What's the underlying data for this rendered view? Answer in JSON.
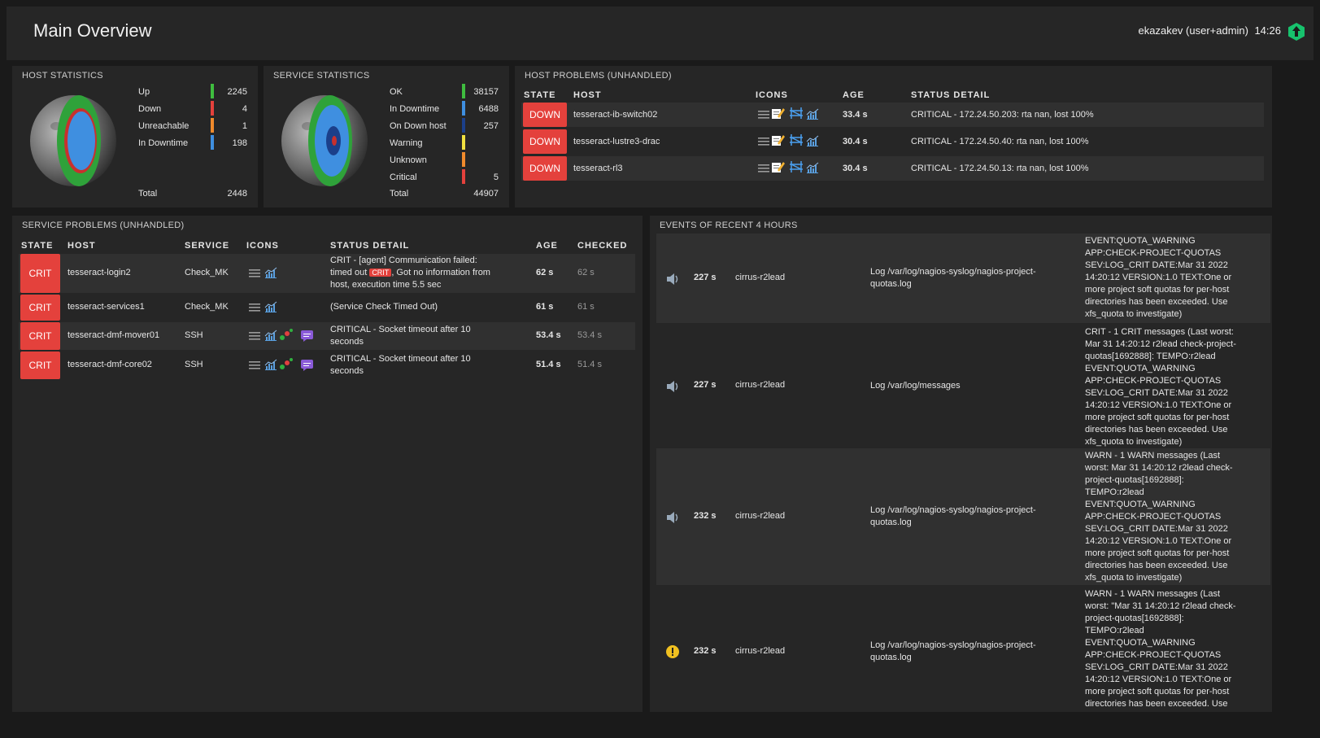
{
  "header": {
    "title": "Main Overview",
    "user": "ekazakev (user+admin)",
    "time": "14:26",
    "logo_icon": "checkmk-logo-icon"
  },
  "host_stats": {
    "title": "HOST STATISTICS",
    "rows": [
      {
        "label": "Up",
        "value": "2245",
        "color": "#3fbd3f"
      },
      {
        "label": "Down",
        "value": "4",
        "color": "#e4413c"
      },
      {
        "label": "Unreachable",
        "value": "1",
        "color": "#f08a2c"
      },
      {
        "label": "In Downtime",
        "value": "198",
        "color": "#3f8fe0"
      }
    ],
    "total_label": "Total",
    "total_value": "2448"
  },
  "service_stats": {
    "title": "SERVICE STATISTICS",
    "rows": [
      {
        "label": "OK",
        "value": "38157",
        "color": "#3fbd3f"
      },
      {
        "label": "In Downtime",
        "value": "6488",
        "color": "#3f8fe0"
      },
      {
        "label": "On Down host",
        "value": "257",
        "color": "#1b3f8a"
      },
      {
        "label": "Warning",
        "value": "",
        "color": "#f0e040"
      },
      {
        "label": "Unknown",
        "value": "",
        "color": "#f08a2c"
      },
      {
        "label": "Critical",
        "value": "5",
        "color": "#e4413c"
      }
    ],
    "total_label": "Total",
    "total_value": "44907"
  },
  "host_problems": {
    "title": "HOST PROBLEMS (UNHANDLED)",
    "columns": [
      "STATE",
      "HOST",
      "ICONS",
      "AGE",
      "STATUS DETAIL"
    ],
    "rows": [
      {
        "state": "DOWN",
        "host": "tesseract-ib-switch02",
        "age": "33.4 s",
        "detail": "CRITICAL - 172.24.50.203: rta nan, lost 100%"
      },
      {
        "state": "DOWN",
        "host": "tesseract-lustre3-drac",
        "age": "30.4 s",
        "detail": "CRITICAL - 172.24.50.40: rta nan, lost 100%"
      },
      {
        "state": "DOWN",
        "host": "tesseract-rl3",
        "age": "30.4 s",
        "detail": "CRITICAL - 172.24.50.13: rta nan, lost 100%"
      }
    ]
  },
  "service_problems": {
    "title": "SERVICE PROBLEMS (UNHANDLED)",
    "columns": [
      "STATE",
      "HOST",
      "SERVICE",
      "ICONS",
      "STATUS DETAIL",
      "AGE",
      "CHECKED"
    ],
    "rows": [
      {
        "state": "CRIT",
        "host": "tesseract-login2",
        "service": "Check_MK",
        "detail_line1": "CRIT - [agent] Communication failed:",
        "detail_pre": "timed out ",
        "detail_badge": "CRIT",
        "detail_post": ", Got no information from",
        "detail_line3": "host, execution time 5.5 sec",
        "age": "62 s",
        "checked": "62 s"
      },
      {
        "state": "CRIT",
        "host": "tesseract-services1",
        "service": "Check_MK",
        "detail": "(Service Check Timed Out)",
        "age": "61 s",
        "checked": "61 s"
      },
      {
        "state": "CRIT",
        "host": "tesseract-dmf-mover01",
        "service": "SSH",
        "detail_line1": "CRITICAL - Socket timeout after 10",
        "detail_line2": "seconds",
        "age": "53.4 s",
        "checked": "53.4 s"
      },
      {
        "state": "CRIT",
        "host": "tesseract-dmf-core02",
        "service": "SSH",
        "detail_line1": "CRITICAL - Socket timeout after 10",
        "detail_line2": "seconds",
        "age": "51.4 s",
        "checked": "51.4 s"
      }
    ]
  },
  "events": {
    "title": "EVENTS OF RECENT 4 HOURS",
    "rows": [
      {
        "icon": "speaker-icon",
        "age": "227 s",
        "host": "cirrus-r2lead",
        "log": [
          "Log /var/log/nagios-syslog/nagios-project-",
          "quotas.log"
        ],
        "text": [
          "EVENT:QUOTA_WARNING",
          "APP:CHECK-PROJECT-QUOTAS",
          "SEV:LOG_CRIT DATE:Mar 31 2022",
          "14:20:12 VERSION:1.0 TEXT:One or",
          "more project soft quotas for per-host",
          "directories has been exceeded. Use",
          "xfs_quota to investigate)"
        ]
      },
      {
        "icon": "speaker-icon",
        "age": "227 s",
        "host": "cirrus-r2lead",
        "log": [
          "Log /var/log/messages"
        ],
        "text": [
          "CRIT - 1 CRIT messages (Last worst:",
          "Mar 31 14:20:12 r2lead check-project-",
          "quotas[1692888]: TEMPO:r2lead",
          "EVENT:QUOTA_WARNING",
          "APP:CHECK-PROJECT-QUOTAS",
          "SEV:LOG_CRIT DATE:Mar 31 2022",
          "14:20:12 VERSION:1.0 TEXT:One or",
          "more project soft quotas for per-host",
          "directories has been exceeded. Use",
          "xfs_quota to investigate)"
        ]
      },
      {
        "icon": "speaker-icon",
        "age": "232 s",
        "host": "cirrus-r2lead",
        "log": [
          "Log /var/log/nagios-syslog/nagios-project-",
          "quotas.log"
        ],
        "text": [
          "WARN - 1 WARN messages (Last",
          "worst: Mar 31 14:20:12 r2lead check-",
          "project-quotas[1692888]:",
          "TEMPO:r2lead",
          "EVENT:QUOTA_WARNING",
          "APP:CHECK-PROJECT-QUOTAS",
          "SEV:LOG_CRIT DATE:Mar 31 2022",
          "14:20:12 VERSION:1.0 TEXT:One or",
          "more project soft quotas for per-host",
          "directories has been exceeded. Use",
          "xfs_quota to investigate)"
        ]
      },
      {
        "icon": "warning-icon",
        "age": "232 s",
        "host": "cirrus-r2lead",
        "log": [
          "Log /var/log/nagios-syslog/nagios-project-",
          "quotas.log"
        ],
        "text": [
          "WARN - 1 WARN messages (Last",
          "worst: \"Mar 31 14:20:12 r2lead check-",
          "project-quotas[1692888]:",
          "TEMPO:r2lead",
          "EVENT:QUOTA_WARNING",
          "APP:CHECK-PROJECT-QUOTAS",
          "SEV:LOG_CRIT DATE:Mar 31 2022",
          "14:20:12 VERSION:1.0 TEXT:One or",
          "more project soft quotas for per-host",
          "directories has been exceeded. Use"
        ]
      }
    ]
  }
}
